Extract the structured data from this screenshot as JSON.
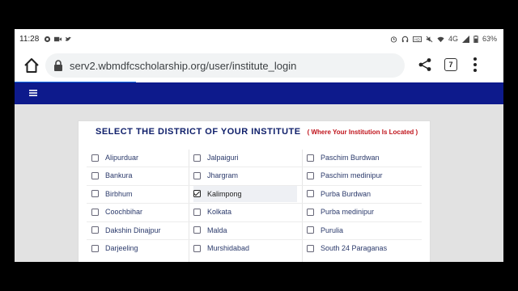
{
  "status": {
    "time": "11:28",
    "battery": "63%",
    "network": "4G"
  },
  "browser": {
    "url": "serv2.wbmdfcscholarship.org/user/institute_login",
    "tab_count": "7"
  },
  "card": {
    "title": "SELECT THE DISTRICT OF YOUR INSTITUTE",
    "subtitle": "( Where Your Institution Is Located )"
  },
  "districts": {
    "col1": [
      "Alipurduar",
      "Bankura",
      "Birbhum",
      "Coochbihar",
      "Dakshin Dinajpur",
      "Darjeeling"
    ],
    "col2": [
      "Jalpaiguri",
      "Jhargram",
      "Kalimpong",
      "Kolkata",
      "Malda",
      "Murshidabad"
    ],
    "col3": [
      "Paschim Burdwan",
      "Paschim medinipur",
      "Purba Burdwan",
      "Purba medinipur",
      "Purulia",
      "South 24 Paraganas"
    ],
    "selected": "Kalimpong"
  },
  "colors": {
    "navbar": "#0d1a8c",
    "title": "#10206b",
    "subtitle": "#c0141c",
    "progress": "#1a73e8"
  }
}
